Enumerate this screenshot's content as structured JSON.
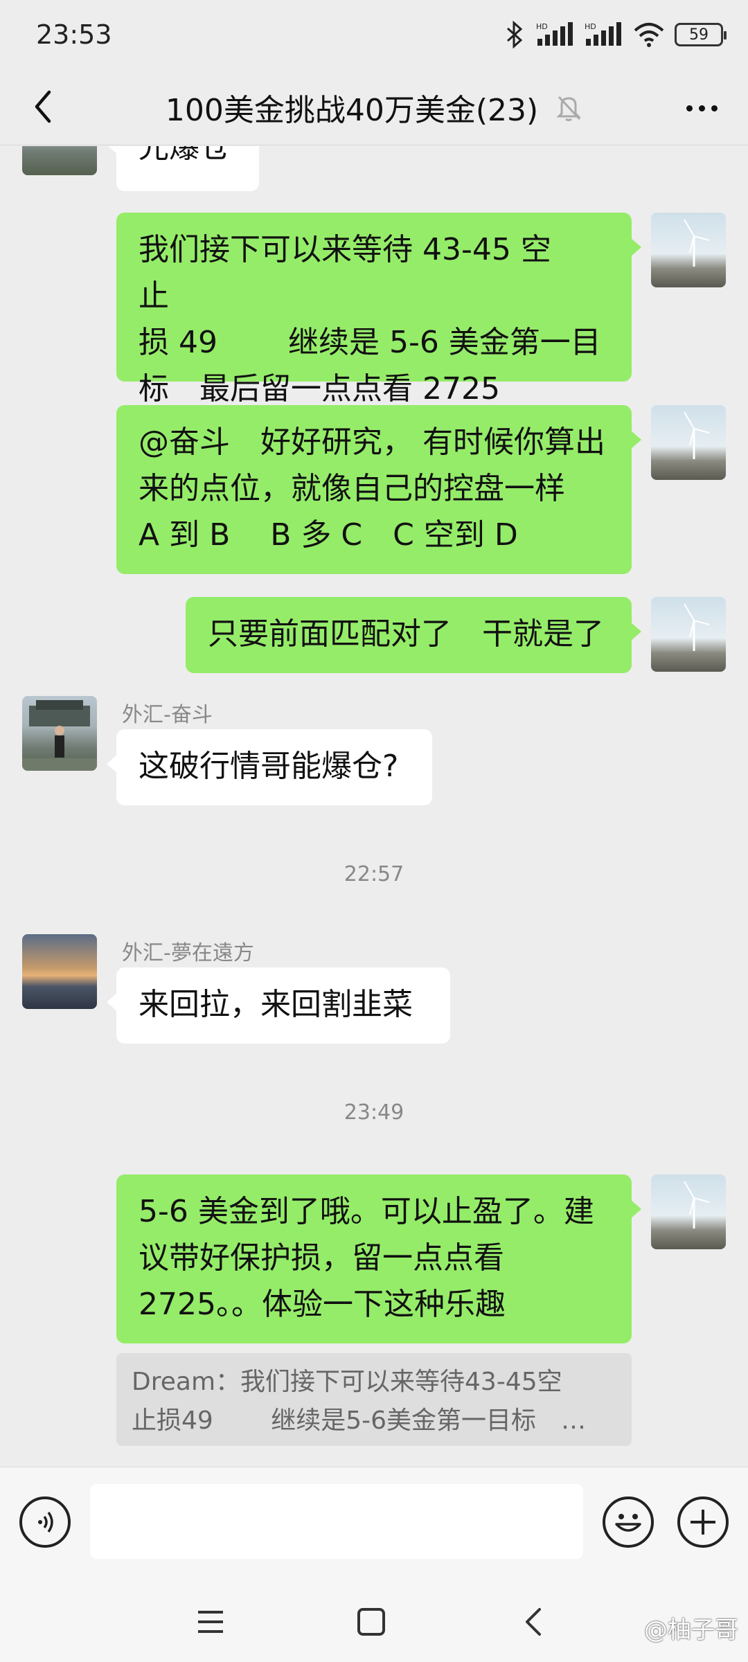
{
  "status": {
    "time": "23:53",
    "battery": "59"
  },
  "header": {
    "title": "100美金挑战40万美金(23)"
  },
  "messages": [
    {
      "text": "光爆仓"
    },
    {
      "lines": [
        "我们接下可以来等待 43-45 空　止",
        "损 49　　 继续是 5-6 美金第一目",
        "标　最后留一点点看 2725"
      ]
    },
    {
      "lines": [
        "@奋斗　好好研究，  有时候你算出",
        "来的点位，就像自己的控盘一样",
        "A 到 B　 B 多 C　C 空到 D"
      ]
    },
    {
      "lines": [
        "只要前面匹配对了　干就是了"
      ]
    },
    {
      "sender": "外汇-奋斗",
      "lines": [
        "这破行情哥能爆仓?"
      ]
    },
    {
      "time": "22:57"
    },
    {
      "sender": "外汇-夢在遠方",
      "lines": [
        "来回拉，来回割韭菜"
      ]
    },
    {
      "time": "23:49"
    },
    {
      "lines": [
        "5-6 美金到了哦。可以止盈了。建",
        "议带好保护损，留一点点看",
        "2725。。体验一下这种乐趣"
      ]
    }
  ],
  "quote": {
    "lines": [
      "Dream：我们接下可以来等待43-45空",
      "止损49　　 继续是5-6美金第一目标　…"
    ]
  },
  "watermark": "@柚子哥",
  "icons": {
    "back": "chevron-left-icon",
    "mute": "bell-off-icon",
    "more": "more-dots-icon",
    "voice": "voice-icon",
    "emoji": "emoji-icon",
    "plus": "plus-icon"
  }
}
